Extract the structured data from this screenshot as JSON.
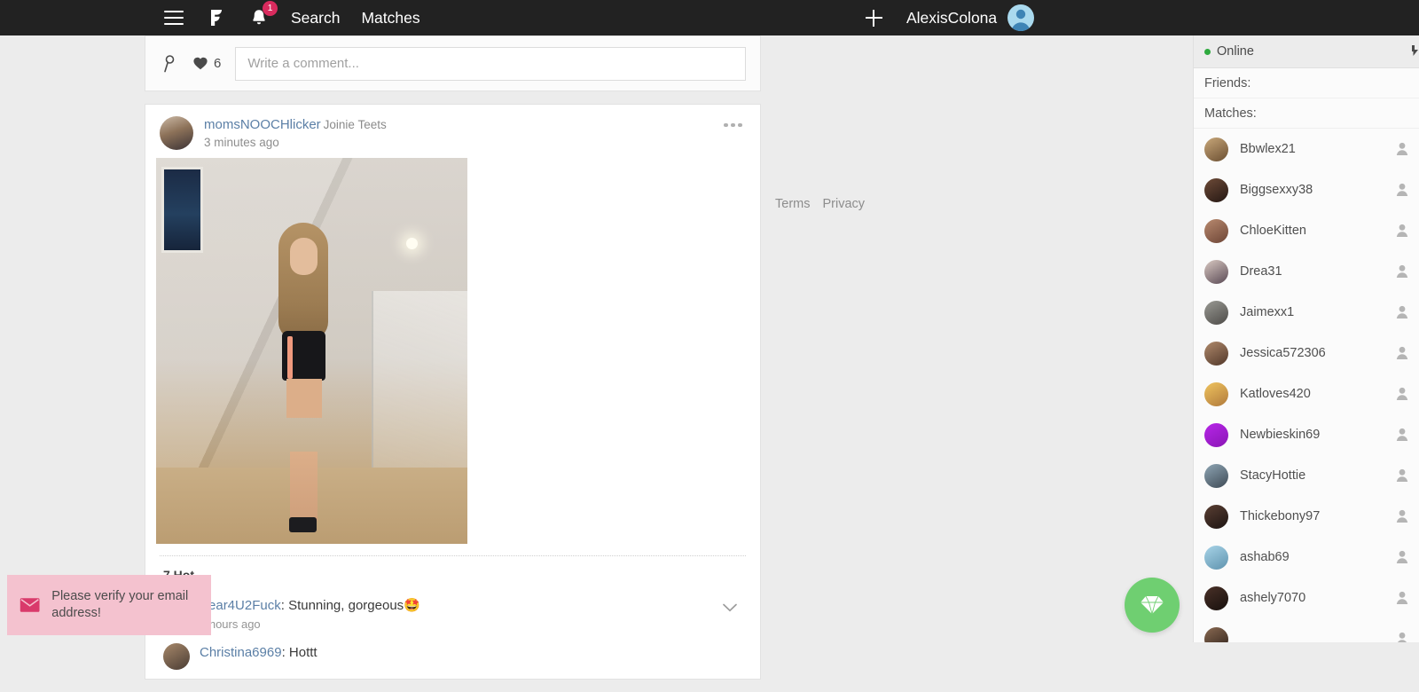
{
  "topbar": {
    "menu_icon": "hamburger-menu-icon",
    "logo_icon": "brand-f-logo-icon",
    "bell_icon": "notification-bell-icon",
    "notification_count": "1",
    "search_label": "Search",
    "matches_label": "Matches",
    "plus_icon": "plus-icon",
    "username": "AlexisColona",
    "avatar_icon": "user-avatar-icon",
    "background_color": "#222222"
  },
  "comment_bar": {
    "pin_icon": "pin-icon",
    "heart_icon": "heart-icon",
    "heart_count": "6",
    "input_placeholder": "Write a comment...",
    "input_value": ""
  },
  "post": {
    "username": "momsNOOCHlicker",
    "display_name": "Joinie Teets",
    "timestamp": "3 minutes ago",
    "more_icon": "more-options-icon",
    "photo_alt": "post-photo",
    "hot_count_label": "7 Hot",
    "comments": [
      {
        "author": "Bear4U2Fuck",
        "separator": ": ",
        "text": "Stunning, gorgeous",
        "emoji": "🤩",
        "timestamp": "2 hours ago",
        "expand_icon": "chevron-down-icon"
      },
      {
        "author": "Christina6969",
        "separator": ": ",
        "text": "Hottt",
        "emoji": "",
        "timestamp": "",
        "expand_icon": ""
      }
    ]
  },
  "legal": {
    "terms_label": "Terms",
    "privacy_label": "Privacy"
  },
  "sidebar": {
    "status_label": "Online",
    "status_color": "#2faa3f",
    "status_icon": "expand-sidebar-icon",
    "friends_label": "Friends:",
    "matches_label": "Matches:",
    "matches": [
      {
        "name": "Bbwlex21",
        "avatar_color_a": "#c9a87a",
        "avatar_color_b": "#6b4f32",
        "status_icon": "person-icon"
      },
      {
        "name": "Biggsexxy38",
        "avatar_color_a": "#6e4b38",
        "avatar_color_b": "#241713",
        "status_icon": "person-icon"
      },
      {
        "name": "ChloeKitten",
        "avatar_color_a": "#b98a6f",
        "avatar_color_b": "#6d4536",
        "status_icon": "person-icon"
      },
      {
        "name": "Drea31",
        "avatar_color_a": "#d9c9c2",
        "avatar_color_b": "#5a4a55",
        "status_icon": "person-icon"
      },
      {
        "name": "Jaimexx1",
        "avatar_color_a": "#9a9a94",
        "avatar_color_b": "#4d4b48",
        "status_icon": "person-icon"
      },
      {
        "name": "Jessica572306",
        "avatar_color_a": "#b08a6c",
        "avatar_color_b": "#52382a",
        "status_icon": "person-icon"
      },
      {
        "name": "Katloves420",
        "avatar_color_a": "#f0c45e",
        "avatar_color_b": "#b07a3c",
        "status_icon": "person-icon"
      },
      {
        "name": "Newbieskin69",
        "avatar_color_a": "#b726e8",
        "avatar_color_b": "#8a16b5",
        "status_icon": "person-icon"
      },
      {
        "name": "StacyHottie",
        "avatar_color_a": "#8fa6b5",
        "avatar_color_b": "#3e4a55",
        "status_icon": "person-icon"
      },
      {
        "name": "Thickebony97",
        "avatar_color_a": "#5a3f33",
        "avatar_color_b": "#1d1412",
        "status_icon": "person-icon"
      },
      {
        "name": "ashab69",
        "avatar_color_a": "#a8d4e8",
        "avatar_color_b": "#5f93ae",
        "status_icon": "person-icon"
      },
      {
        "name": "ashely7070",
        "avatar_color_a": "#4a3128",
        "avatar_color_b": "#17100d",
        "status_icon": "person-icon"
      },
      {
        "name": "",
        "avatar_color_a": "#8a6a52",
        "avatar_color_b": "#2e211a",
        "status_icon": "person-icon"
      }
    ]
  },
  "fab": {
    "icon": "diamond-icon",
    "color": "#6fcf71"
  },
  "toast": {
    "icon": "envelope-icon",
    "message": "Please verify your email address!",
    "background_color": "#f4c2cf",
    "icon_color": "#d93a6b"
  }
}
